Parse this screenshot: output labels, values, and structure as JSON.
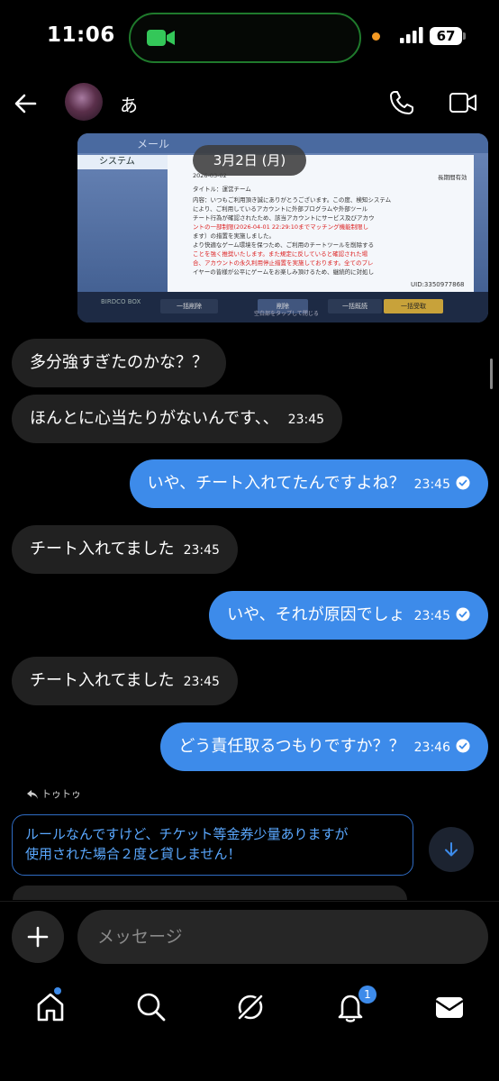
{
  "status_bar": {
    "time": "11:06",
    "battery": "67"
  },
  "header": {
    "contact_name": "あ",
    "icons": [
      "back-arrow-icon",
      "call-icon",
      "video-call-icon"
    ]
  },
  "image_message": {
    "date_label": "3月2日 (月)",
    "screenshot": {
      "top_label": "メール",
      "tab_label": "システム",
      "lines": [
        "2026-03-02",
        "タイトル：運営チーム",
        "内容：いつもご利用頂き誠にありがとうございます。この度、検知システム",
        "により、ご利用しているアカウントに外部プログラムや外部ツール",
        "チート行為が確認されたため、該当アカウントにサービス及びアカウ",
        "ントの一部制限(2026-04-01 22:29:10までマッチング機能制限し",
        "ます）の措置を実施しました。",
        "より快適なゲーム環境を保つため、ご利用のチートツールを削除する",
        "ことを強く推奨いたします。また規定に反していると確認された場",
        "合、アカウントの永久利用停止措置を実施しております。全てのプレ",
        "イヤーの皆様が公平にゲームをお楽しみ頂けるため、継続的に対処し"
      ],
      "right_label": "長期間有効",
      "uid": "UID:3350977868",
      "buttons": [
        "一括削除",
        "削除",
        "一括既読",
        "一括受取"
      ],
      "tap_hint": "空白部をタップして閉じる",
      "box_logo": "BIRDCO BOX"
    }
  },
  "messages": [
    {
      "dir": "in",
      "text": "多分強すぎたのかな？？",
      "time": ""
    },
    {
      "dir": "in",
      "text": "ほんとに心当たりがないんです、、",
      "time": "23:45"
    },
    {
      "dir": "out",
      "text": "いや、チート入れてたんですよね？",
      "time": "23:45"
    },
    {
      "dir": "in",
      "text": "チート入れてました",
      "time": "23:45"
    },
    {
      "dir": "out",
      "text": "いや、それが原因でしょ",
      "time": "23:45"
    },
    {
      "dir": "in",
      "text": "チート入れてました",
      "time": "23:45"
    },
    {
      "dir": "out",
      "text": "どう責任取るつもりですか？？",
      "time": "23:46"
    }
  ],
  "reply": {
    "label": "トゥトゥ",
    "quoted_text_line1": "ルールなんですけど、チケット等金券少量ありますが",
    "quoted_text_line2": "使用された場合２度と貸しません！"
  },
  "composer": {
    "placeholder": "メッセージ"
  },
  "nav": {
    "items": [
      "home-icon",
      "search-icon",
      "grok-icon",
      "notifications-icon",
      "messages-icon"
    ],
    "notification_count": "1"
  },
  "colors": {
    "accent": "#3d8bea",
    "incoming_bubble": "#212121",
    "background": "#000000"
  }
}
